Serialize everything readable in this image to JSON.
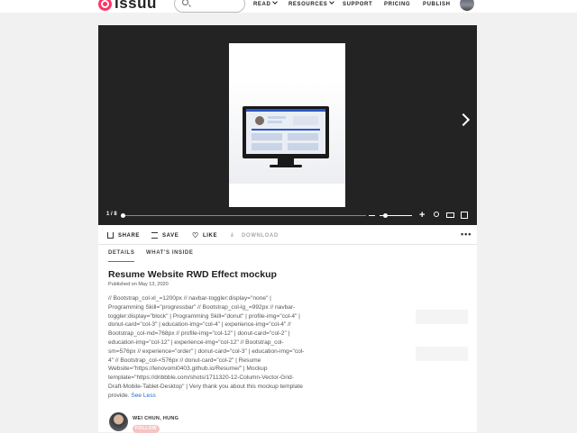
{
  "header": {
    "logo_text": "issuu",
    "search_placeholder": "",
    "nav": [
      {
        "label": "READ"
      },
      {
        "label": "RESOURCES"
      },
      {
        "label": "SUPPORT"
      },
      {
        "label": "PRICING"
      },
      {
        "label": "PUBLISH"
      }
    ]
  },
  "viewer": {
    "page_indicator": "1 / 8",
    "progress_fraction": 0.0
  },
  "actions": {
    "share": "SHARE",
    "save": "SAVE",
    "like": "LIKE",
    "download": "DOWNLOAD",
    "more": "•••"
  },
  "tabs": [
    {
      "label": "DETAILS",
      "active": true
    },
    {
      "label": "WHAT'S INSIDE",
      "active": false
    }
  ],
  "doc": {
    "title": "Resume Website RWD Effect mockup",
    "published": "Published on May 13, 2020",
    "description": "// Bootstrap_col-xl_=1200px // navbar-toggler:display=\"none\" | Programming Skill=\"progressbar\" // Bootstrap_col-lg_=992px // navbar-toggler:display=\"block\" | Programming Skill=\"donut\" | profile-img=\"col-4\" | donut-card=\"col-3\" | education-img=\"col-4\" | experience-img=\"col-4\" // Bootstrap_col-md=768px // profile-img=\"col-12\" | donut-card=\"col-2\" | education-img=\"col-12\" | experience-img=\"col-12\" // Bootstrap_col-sm=576px // experience=\"order\" | donut-card=\"col-3\" | education-img=\"col-4\" // Bootstrap_col-<576px // donut-card=\"col-2\" | Resume Website=\"https://lenovomi0403.github.io/Resume/\" | Mockup template=\"https://dribbble.com/shots/1711320-12-Column-Vector-Grid-Draft-Mobile-Tablet-Desktop\" | Very thank you about this mockup template provide.",
    "see_less": "See Less"
  },
  "author": {
    "name": "WEI CHUN, HUNG",
    "follow": "FOLLOW"
  },
  "colors": {
    "accent": "#ff3366",
    "link": "#1b6fe0",
    "viewer_bg": "#232323"
  }
}
